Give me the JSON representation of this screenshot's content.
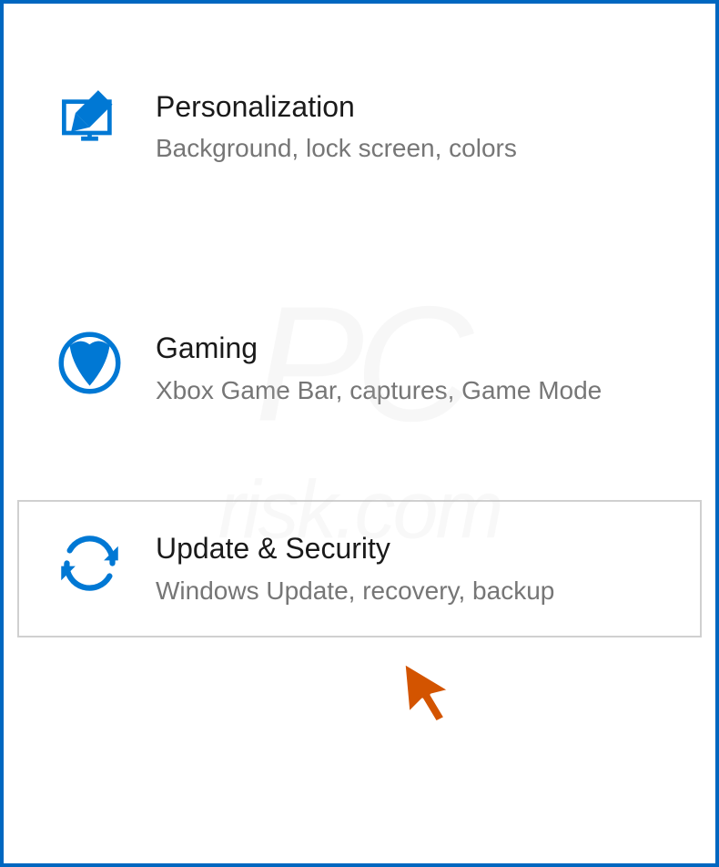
{
  "settings": {
    "items": [
      {
        "title": "Personalization",
        "description": "Background, lock screen, colors"
      },
      {
        "title": "Gaming",
        "description": "Xbox Game Bar, captures, Game Mode"
      },
      {
        "title": "Update & Security",
        "description": "Windows Update, recovery, backup"
      }
    ]
  },
  "watermark": {
    "main": "PC",
    "sub": "risk.com"
  }
}
